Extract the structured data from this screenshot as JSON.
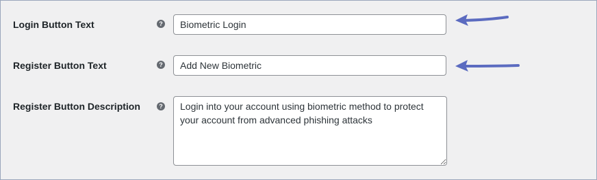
{
  "settings": {
    "login_button": {
      "label": "Login Button Text",
      "help_icon": "question-circle-icon",
      "value": "Biometric Login"
    },
    "register_button": {
      "label": "Register Button Text",
      "help_icon": "question-circle-icon",
      "value": "Add New Biometric"
    },
    "register_description": {
      "label": "Register Button Description",
      "help_icon": "question-circle-icon",
      "value": "Login into your account using biometric method to protect your account from advanced phishing attacks"
    }
  },
  "annotations": {
    "arrow_color": "#5b6bc0",
    "arrow_icon": "left-arrow-icon"
  },
  "colors": {
    "background": "#f0f0f1",
    "border": "#9aa6bb",
    "help_icon": "#646970"
  }
}
